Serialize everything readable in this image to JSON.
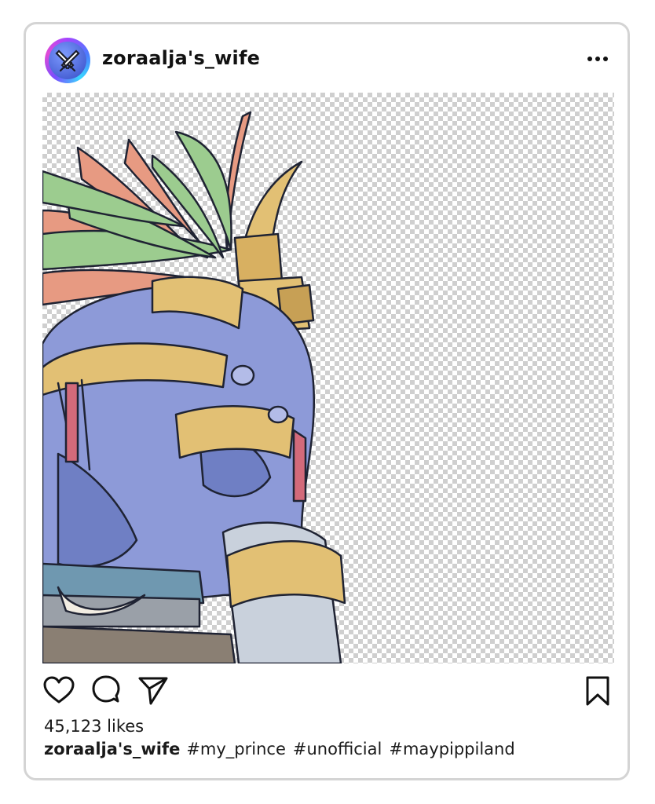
{
  "post": {
    "username": "zoraalja's_wife",
    "likes": "45,123 likes",
    "caption_user": "zoraalja's_wife",
    "hashtags": [
      "#my_prince",
      "#unofficial",
      "#maypippiland"
    ]
  },
  "icons": {
    "avatar": "crossed-swords-icon",
    "more": "more-horizontal-icon",
    "like": "heart-icon",
    "comment": "comment-icon",
    "share": "send-icon",
    "save": "bookmark-icon"
  },
  "colors": {
    "skin": "#8d9ad8",
    "gold": "#e2c074",
    "feather_green": "#9ccc8f",
    "feather_salmon": "#e79a82",
    "outline": "#1f2333"
  }
}
